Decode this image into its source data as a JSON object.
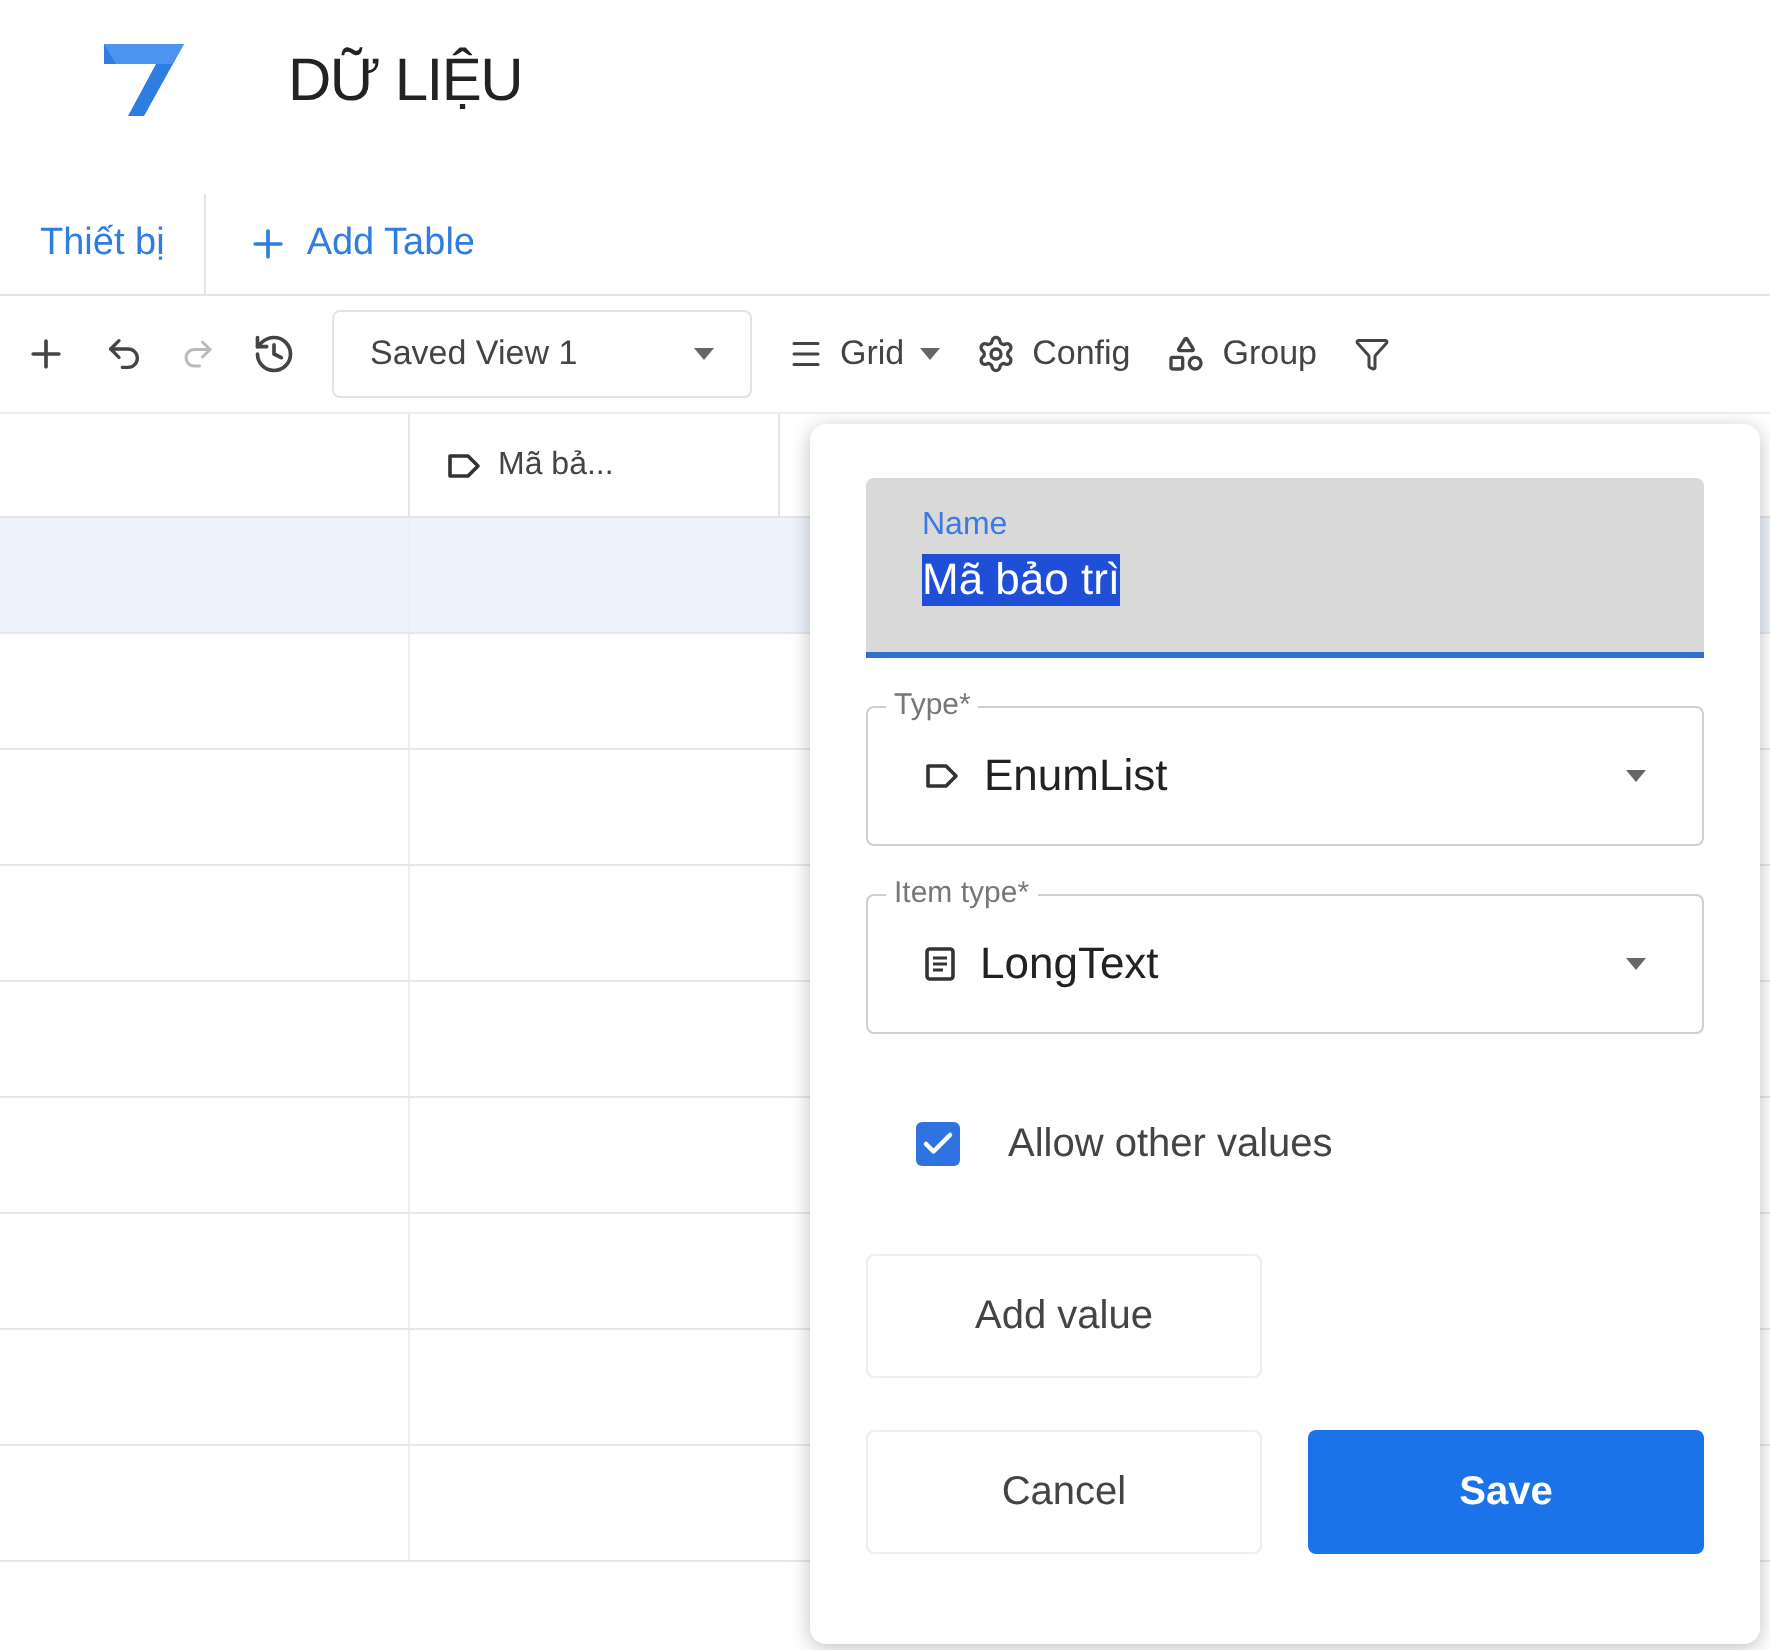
{
  "header": {
    "title": "DỮ LIỆU"
  },
  "tabs": [
    {
      "label": "Thiết bị",
      "selected": true
    },
    {
      "label": "Add Table",
      "kind": "add",
      "selected": false
    }
  ],
  "toolbar": {
    "view": "Saved View 1",
    "layout": "Grid",
    "config": "Config",
    "group": "Group"
  },
  "table": {
    "columns": [
      {},
      {
        "label": "Mã bả..."
      }
    ],
    "rows": [
      {
        "selected": true
      },
      {
        "selected": false
      },
      {
        "selected": false
      },
      {
        "selected": false
      },
      {
        "selected": false
      },
      {
        "selected": false
      },
      {
        "selected": false
      },
      {
        "selected": false
      },
      {
        "selected": false
      }
    ]
  },
  "editor": {
    "name": {
      "label": "Name",
      "value": "Mã bảo trì"
    },
    "type": {
      "label": "Type*",
      "value": "EnumList"
    },
    "item_type": {
      "label": "Item type*",
      "value": "LongText"
    },
    "allow_other": {
      "label": "Allow other values",
      "checked": true
    },
    "add_value": "Add value",
    "cancel": "Cancel",
    "save": "Save"
  }
}
